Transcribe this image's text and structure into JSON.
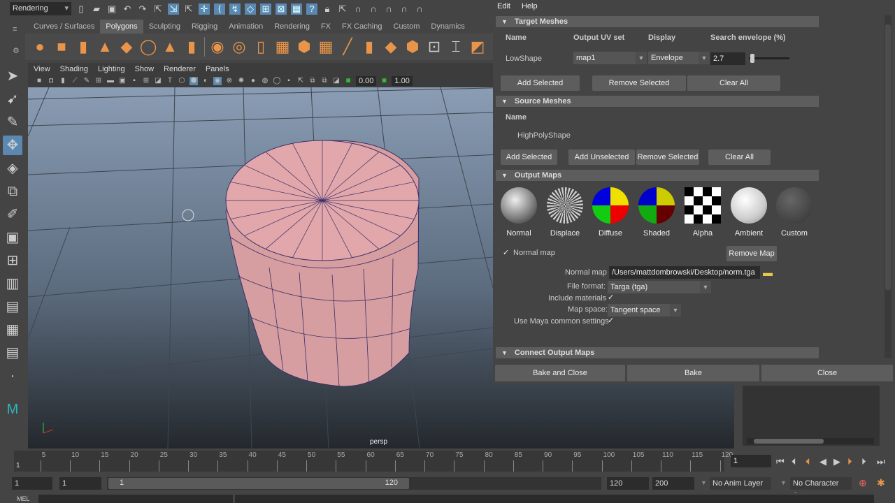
{
  "toolbar": {
    "workspace": "Rendering"
  },
  "shelf": {
    "tabs": [
      "Curves / Surfaces",
      "Polygons",
      "Sculpting",
      "Rigging",
      "Animation",
      "Rendering",
      "FX",
      "FX Caching",
      "Custom",
      "Dynamics"
    ],
    "active": "Polygons"
  },
  "viewport": {
    "menu": [
      "View",
      "Shading",
      "Lighting",
      "Show",
      "Renderer",
      "Panels"
    ],
    "exposure": "0.00",
    "gamma": "1.00",
    "camera_label": "persp"
  },
  "dialog": {
    "menu": [
      "Edit",
      "Help"
    ],
    "target": {
      "title": "Target Meshes",
      "headers": [
        "Name",
        "Output UV set",
        "Display",
        "Search envelope (%)"
      ],
      "row": {
        "name": "LowShape",
        "uv_set": "map1",
        "display": "Envelope",
        "envelope": "2.7"
      },
      "buttons": [
        "Add Selected",
        "Remove Selected",
        "Clear All"
      ],
      "envelope_slider": 0.03
    },
    "source": {
      "title": "Source Meshes",
      "header": "Name",
      "row": "HighPolyShape",
      "buttons": [
        "Add Selected",
        "Add Unselected",
        "Remove Selected",
        "Clear All"
      ]
    },
    "output": {
      "title": "Output Maps",
      "maps": [
        "Normal",
        "Displace",
        "Diffuse",
        "Shaded",
        "Alpha",
        "Ambient",
        "Custom"
      ],
      "normal_map_check": "Normal map",
      "remove_map": "Remove Map",
      "normal_map_label": "Normal map",
      "normal_map_path": "/Users/mattdombrowski/Desktop/norm.tga",
      "file_format_label": "File format:",
      "file_format": "Targa (tga)",
      "include_materials_label": "Include materials",
      "map_space_label": "Map space:",
      "map_space": "Tangent space",
      "use_common_label": "Use Maya common settings"
    },
    "connect": {
      "title": "Connect Output Maps"
    },
    "footer": [
      "Bake and Close",
      "Bake",
      "Close"
    ]
  },
  "timeline": {
    "ticks": [
      5,
      10,
      15,
      20,
      25,
      30,
      35,
      40,
      45,
      50,
      55,
      60,
      65,
      70,
      75,
      80,
      85,
      90,
      95,
      100,
      105,
      110,
      115,
      120
    ],
    "first": "1",
    "current_frame": "1",
    "range_start": "1",
    "play_start": "1",
    "slider_start": "1",
    "slider_end": "120",
    "play_end": "120",
    "range_end": "200",
    "anim_layer": "No Anim Layer",
    "char_set": "No Character Set",
    "mel": "MEL"
  }
}
